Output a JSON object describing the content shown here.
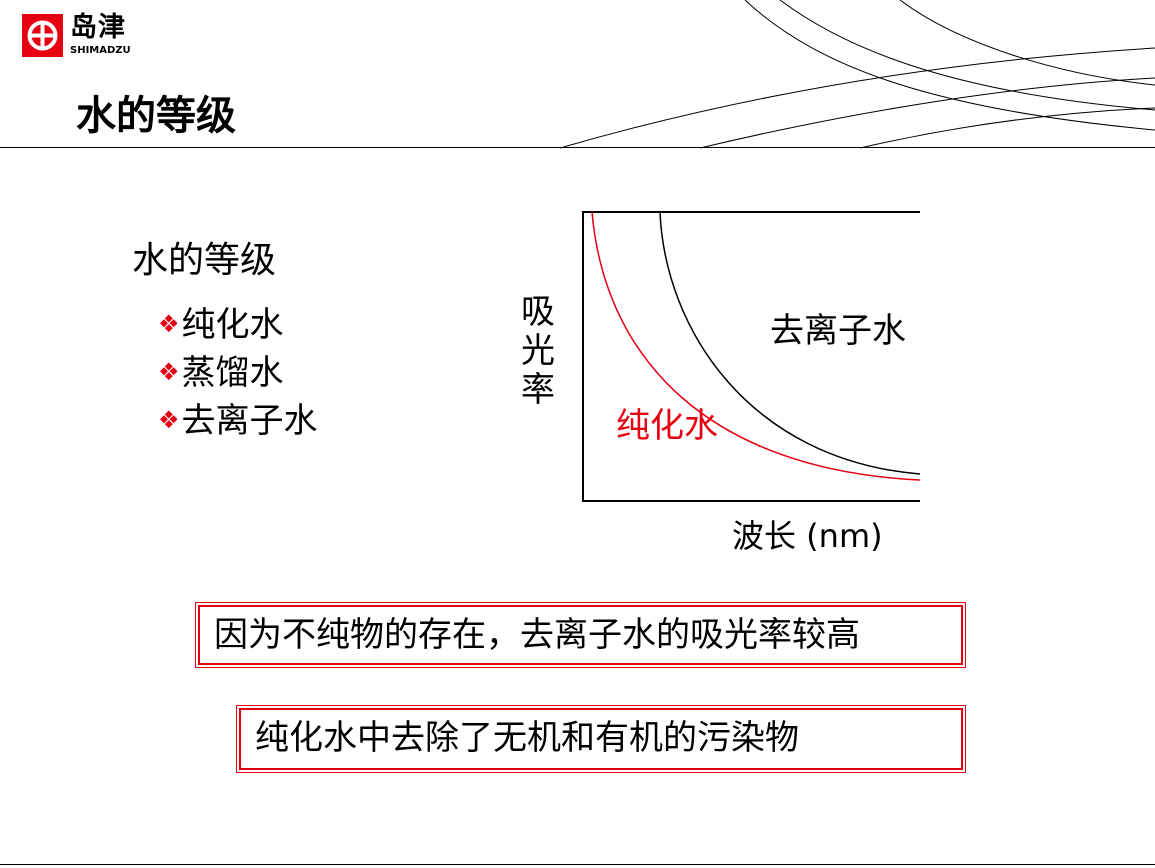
{
  "brand": {
    "name_cn": "岛津",
    "name_en": "SHIMADZU",
    "mark_color": "#e50012"
  },
  "page": {
    "title": "水的等级"
  },
  "list": {
    "heading": "水的等级",
    "bullet_icon": "diamond-bullet-icon",
    "bullet_color": "#e50012",
    "items": [
      "纯化水",
      "蒸馏水",
      "去离子水"
    ]
  },
  "chart_data": {
    "type": "line",
    "xlabel": "波长 (nm)",
    "ylabel": "吸光率",
    "grid": false,
    "legend": "none",
    "ticks": "none",
    "series": [
      {
        "name": "去离子水",
        "color": "#000000",
        "shape": "decaying absorbance curve, higher absorbance"
      },
      {
        "name": "纯化水",
        "color": "#e50012",
        "shape": "decaying absorbance curve, lower absorbance"
      }
    ]
  },
  "notes": [
    {
      "text": "因为不纯物的存在，去离子水的吸光率较高"
    },
    {
      "text": "纯化水中去除了无机和有机的污染物"
    }
  ],
  "colors": {
    "accent": "#e50012",
    "text": "#000000"
  }
}
